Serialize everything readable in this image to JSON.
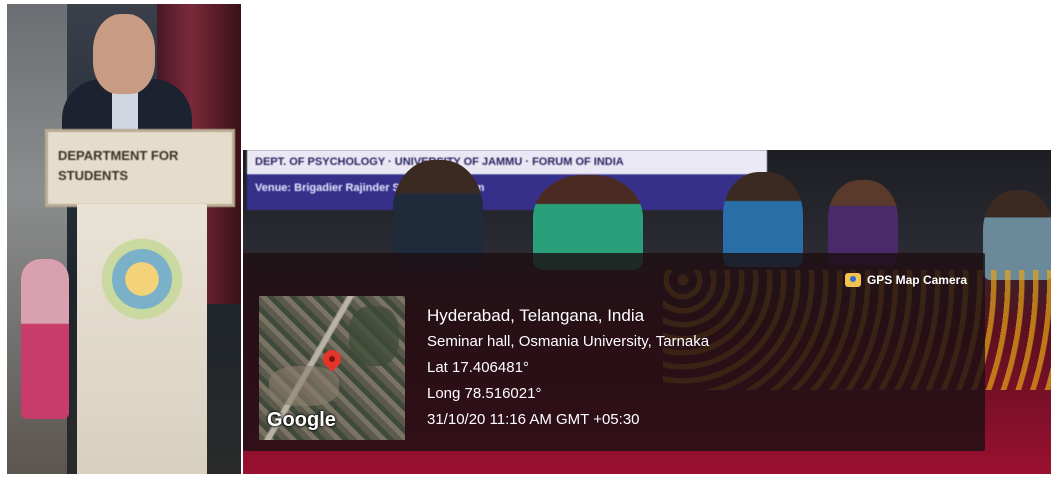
{
  "left_photo": {
    "sign_text": "DEPARTMENT FOR STUDENTS"
  },
  "right_photo": {
    "banner_line1": "DEPT. OF PSYCHOLOGY · UNIVERSITY OF JAMMU · FORUM OF INDIA",
    "banner_line2": "Venue: Brigadier Rajinder Singh Auditorium"
  },
  "gps_overlay": {
    "brand": "GPS Map Camera",
    "brand_icon": "camera-map-icon",
    "map_label": "Google",
    "location": "Hyderabad, Telangana, India",
    "address": "Seminar hall, Osmania University, Tarnaka",
    "latitude": "Lat 17.406481°",
    "longitude": "Long 78.516021°",
    "timestamp": "31/10/20 11:16 AM GMT +05:30"
  }
}
